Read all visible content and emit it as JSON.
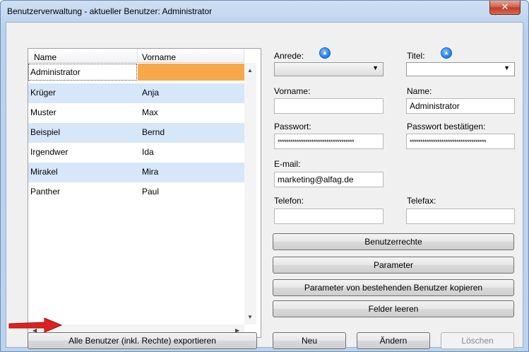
{
  "window": {
    "title": "Benutzerverwaltung - aktueller Benutzer: Administrator",
    "close_label": "✕"
  },
  "list": {
    "columns": [
      "Name",
      "Vorname"
    ],
    "rows": [
      {
        "name": "Administrator",
        "vorname": ""
      },
      {
        "name": "Krüger",
        "vorname": "Anja"
      },
      {
        "name": "Muster",
        "vorname": "Max"
      },
      {
        "name": "Beispiel",
        "vorname": "Bernd"
      },
      {
        "name": "Irgendwer",
        "vorname": "Ida"
      },
      {
        "name": "Mirakel",
        "vorname": "Mira"
      },
      {
        "name": "Panther",
        "vorname": "Paul"
      }
    ],
    "selected_index": 0
  },
  "form": {
    "anrede_label": "Anrede:",
    "anrede_value": "",
    "titel_label": "Titel:",
    "titel_value": "",
    "vorname_label": "Vorname:",
    "vorname_value": "",
    "name_label": "Name:",
    "name_value": "Administrator",
    "passwort_label": "Passwort:",
    "passwort_value": "************************************",
    "passwort2_label": "Passwort bestätigen:",
    "passwort2_value": "************************************",
    "email_label": "E-mail:",
    "email_value": "marketing@alfag.de",
    "telefon_label": "Telefon:",
    "telefon_value": "",
    "telefax_label": "Telefax:",
    "telefax_value": ""
  },
  "buttons": {
    "benutzerrechte": "Benutzerrechte",
    "parameter": "Parameter",
    "parameter_kopieren": "Parameter von bestehenden Benutzer kopieren",
    "felder_leeren": "Felder leeren",
    "export": "Alle Benutzer (inkl. Rechte) exportieren",
    "neu": "Neu",
    "aendern": "Ändern",
    "loeschen": "Löschen"
  },
  "colors": {
    "selection": "#f8a84a",
    "alt_row": "#d7e7fa",
    "annotation_arrow": "#e02020"
  }
}
